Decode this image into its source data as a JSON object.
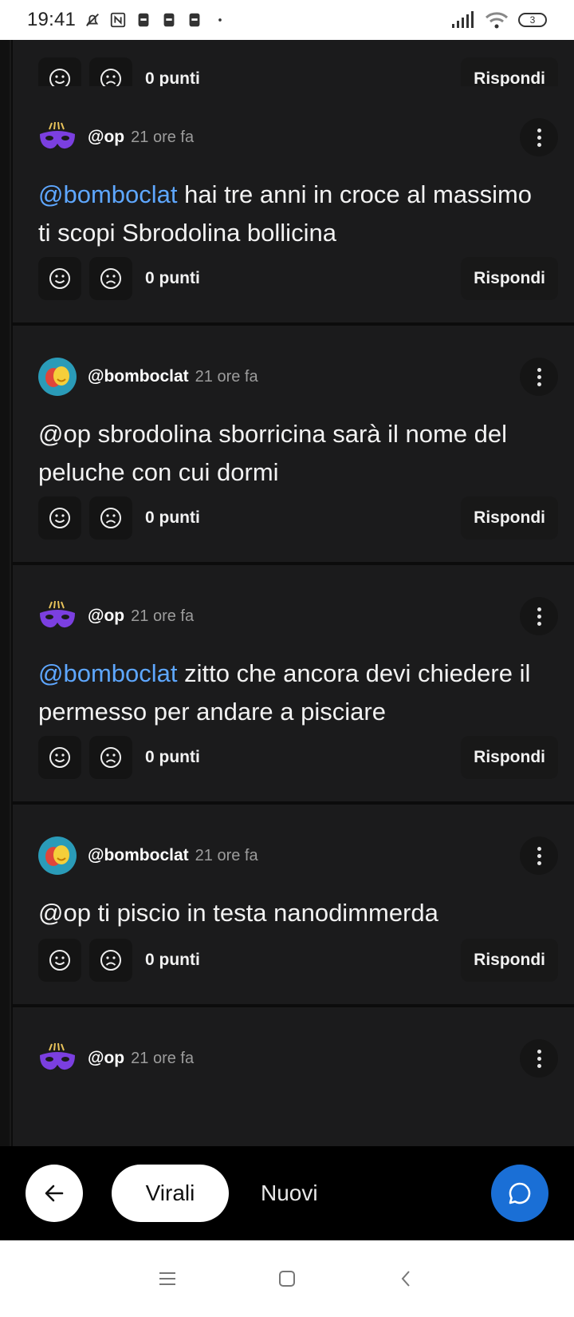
{
  "status_bar": {
    "time": "19:41",
    "battery": "3"
  },
  "feed": {
    "top_partial": {
      "points": "0 punti",
      "reply": "Rispondi"
    },
    "comments": [
      {
        "author": "@op",
        "ago": "21 ore fa",
        "mention": "@bomboclat",
        "text": " hai tre anni in croce al massimo ti scopi Sbrodolina bollicina",
        "points": "0 punti",
        "reply": "Rispondi"
      },
      {
        "author": "@bomboclat",
        "ago": "21 ore fa",
        "mention": "",
        "text": "@op sbrodolina sborricina sarà il nome del peluche con cui dormi",
        "points": "0 punti",
        "reply": "Rispondi"
      },
      {
        "author": "@op",
        "ago": "21 ore fa",
        "mention": "@bomboclat",
        "text": " zitto che ancora devi chiedere il permesso per andare a pisciare",
        "points": "0 punti",
        "reply": "Rispondi"
      },
      {
        "author": "@bomboclat",
        "ago": "21 ore fa",
        "mention": "",
        "text": "@op ti piscio in testa nanodimmerda",
        "points": "0 punti",
        "reply": "Rispondi"
      },
      {
        "author": "@op",
        "ago": "21 ore fa"
      }
    ]
  },
  "bottom_bar": {
    "tab_virali": "Virali",
    "tab_nuovi": "Nuovi"
  },
  "colors": {
    "mention": "#5ea7ff",
    "compose": "#1a6fd6",
    "card": "#1b1b1c"
  },
  "icons": [
    "back-arrow-icon",
    "chat-bubble-icon",
    "smile-icon",
    "frown-icon",
    "more-vert-icon",
    "mask-avatar-icon",
    "theatre-avatar-icon"
  ]
}
